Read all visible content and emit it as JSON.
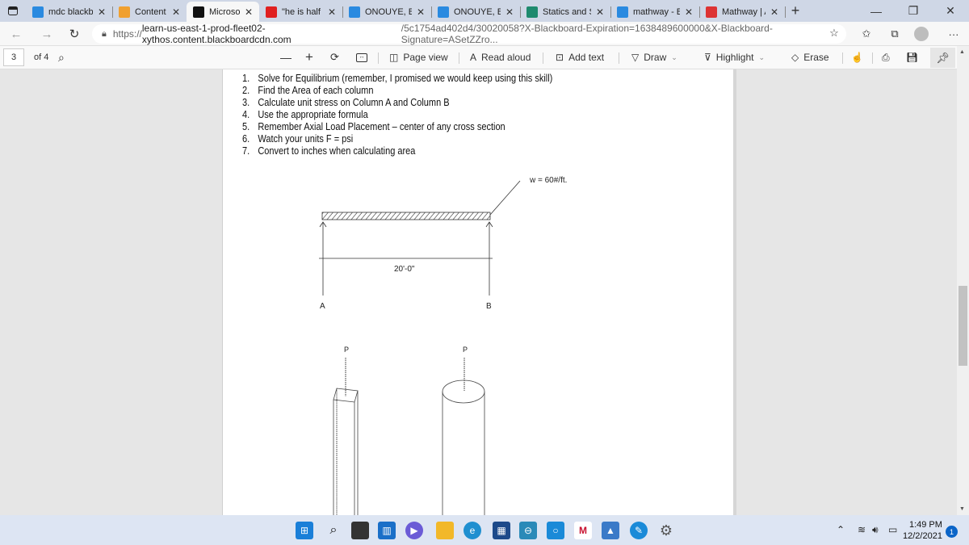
{
  "browser": {
    "tabs": [
      {
        "title": "mdc blackboa",
        "favicon": "bing-icon",
        "color": "#2a8ae0",
        "active": false
      },
      {
        "title": "Content",
        "favicon": "pencil-icon",
        "color": "#f0a030",
        "active": false
      },
      {
        "title": "Microsoft Wor",
        "favicon": "blackboard-icon",
        "color": "#111111",
        "active": true
      },
      {
        "title": "\"he is half of n",
        "favicon": "youtube-icon",
        "color": "#e02020",
        "active": false
      },
      {
        "title": "ONOUYE, Barr",
        "favicon": "bing-icon",
        "color": "#2a8ae0",
        "active": false
      },
      {
        "title": "ONOUYE, Barr",
        "favicon": "bing-icon",
        "color": "#2a8ae0",
        "active": false
      },
      {
        "title": "Statics and Str",
        "favicon": "s-circle-icon",
        "color": "#1e8a6e",
        "active": false
      },
      {
        "title": "mathway - Bin",
        "favicon": "bing-icon",
        "color": "#2a8ae0",
        "active": false
      },
      {
        "title": "Mathway | Alg",
        "favicon": "mathway-icon",
        "color": "#d33",
        "active": false
      }
    ],
    "new_tab": "+",
    "close_glyph": "✕",
    "url_scheme": "https://",
    "url_host": "learn-us-east-1-prod-fleet02-xythos.content.blackboardcdn.com",
    "url_path": "/5c1754ad402d4/30020058?X-Blackboard-Expiration=1638489600000&X-Blackboard-Signature=ASetZZro..."
  },
  "pdf_toolbar": {
    "current_page": "3",
    "page_count": "of 4",
    "zoom_out": "—",
    "zoom_in": "+",
    "page_view": "Page view",
    "read_aloud": "Read aloud",
    "add_text": "Add text",
    "draw": "Draw",
    "highlight": "Highlight",
    "erase": "Erase"
  },
  "document": {
    "steps": [
      {
        "n": "1.",
        "text": "Solve for Equilibrium (remember, I promised we would keep using this skill)"
      },
      {
        "n": "2.",
        "text": "Find the Area of each column"
      },
      {
        "n": "3.",
        "text": "Calculate unit stress on Column A and Column B"
      },
      {
        "n": "4.",
        "text": "Use the appropriate formula"
      },
      {
        "n": "5.",
        "text": "Remember Axial Load Placement – center of any cross section"
      },
      {
        "n": "6.",
        "text": "Watch your units F = psi"
      },
      {
        "n": "7.",
        "text": "Convert to inches when calculating area"
      }
    ],
    "beam": {
      "load_label": "w = 60#/ft.",
      "span_label": "20'-0\"",
      "support_a": "A",
      "support_b": "B"
    },
    "columns": {
      "load_a": "P",
      "load_b": "P"
    }
  },
  "taskbar": {
    "time": "1:49 PM",
    "date": "12/2/2021",
    "notifications": "1"
  }
}
